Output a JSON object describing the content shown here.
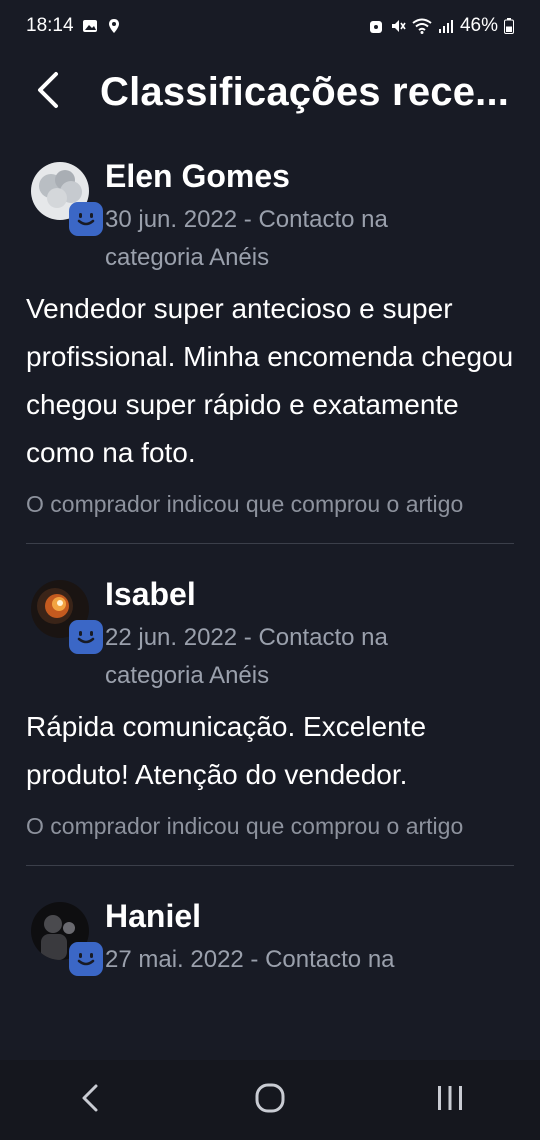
{
  "status_bar": {
    "time": "18:14",
    "battery": "46%",
    "icons": [
      "image-icon",
      "location-icon",
      "lock-icon",
      "mute-icon",
      "wifi-icon",
      "signal-icon",
      "battery-icon"
    ]
  },
  "header": {
    "title": "Classificações rece..."
  },
  "reviews": [
    {
      "name": "Elen Gomes",
      "subline": "30 jun. 2022 - Contacto na categoria Anéis",
      "comment": "Vendedor super antecioso e super profissional. Minha encomenda chegou chegou super rápido e exatamente como na foto.",
      "note": "O comprador indicou que comprou o artigo"
    },
    {
      "name": "Isabel",
      "subline": "22 jun. 2022 - Contacto na categoria Anéis",
      "comment": "Rápida comunicação. Excelente produto! Atenção do vendedor.",
      "note": "O comprador indicou que comprou o artigo"
    },
    {
      "name": "Haniel",
      "subline": "27 mai. 2022 - Contacto na",
      "comment": "",
      "note": ""
    }
  ],
  "colors": {
    "background": "#181b25",
    "badge": "#3b67c6",
    "secondary_text": "#9aa0ac"
  }
}
